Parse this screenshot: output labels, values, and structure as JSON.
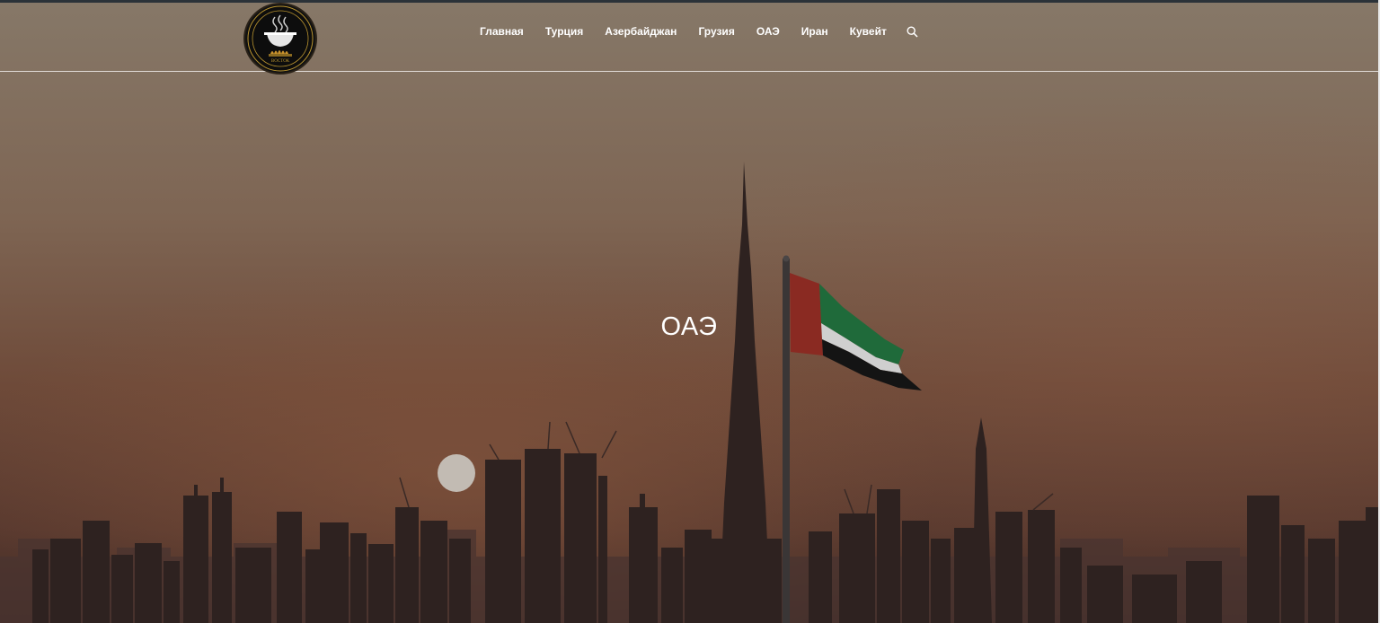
{
  "header": {
    "logo": {
      "alt": "logo",
      "text": "ВОСТОК"
    },
    "nav": {
      "items": [
        {
          "label": "Главная"
        },
        {
          "label": "Турция"
        },
        {
          "label": "Азербайджан"
        },
        {
          "label": "Грузия"
        },
        {
          "label": "ОАЭ"
        },
        {
          "label": "Иран"
        },
        {
          "label": "Кувейт"
        }
      ],
      "search_icon": "search-icon"
    }
  },
  "hero": {
    "title": "ОАЭ",
    "background": "dubai-skyline-sunset-with-uae-flag"
  },
  "colors": {
    "sky_top": "#857667",
    "sky_mid": "#7a5a45",
    "sky_bottom": "#5a3a2e",
    "skyline": "#2f2220",
    "sun": "#c9c5c0",
    "flag_red": "#8a2a22",
    "flag_green": "#1f6a3a",
    "flag_white": "#cfcfcf",
    "flag_black": "#141414",
    "nav_text": "#ffffff"
  }
}
